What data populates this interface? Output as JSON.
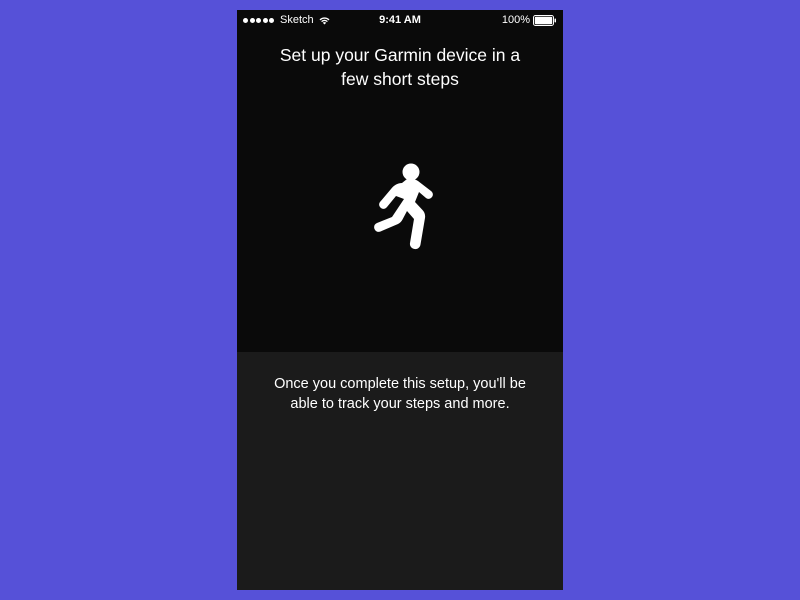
{
  "statusBar": {
    "carrier": "Sketch",
    "time": "9:41 AM",
    "batteryPercent": "100%"
  },
  "content": {
    "title": "Set up your Garmin device in a few short steps",
    "description": "Once you complete this setup, you'll be able to track your steps and more."
  }
}
